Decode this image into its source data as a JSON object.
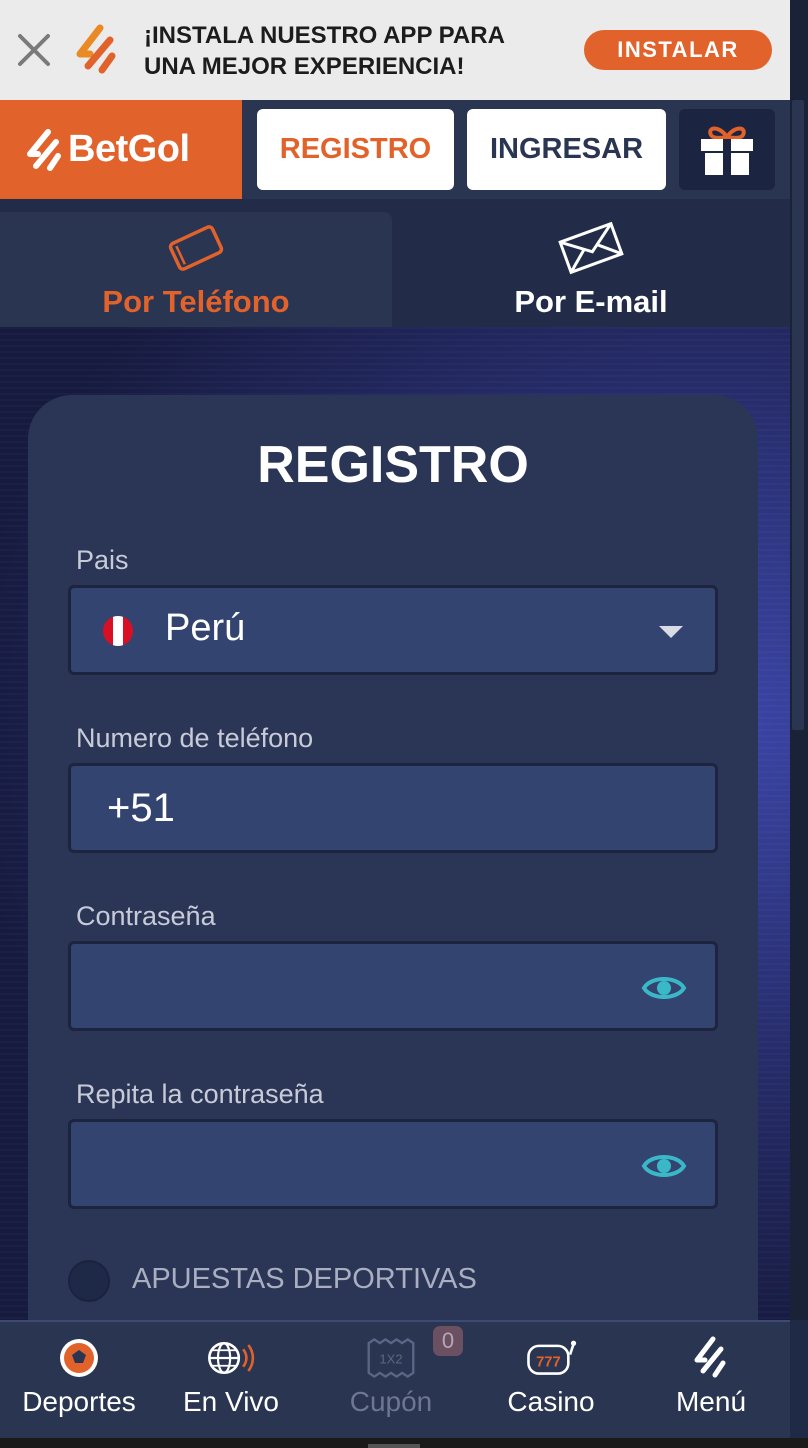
{
  "banner": {
    "message_line1": "¡INSTALA NUESTRO APP PARA",
    "message_line2": "UNA MEJOR EXPERIENCIA!",
    "install_label": "INSTALAR"
  },
  "header": {
    "brand": "BetGol",
    "register_label": "REGISTRO",
    "login_label": "INGRESAR"
  },
  "tabs": [
    {
      "label": "Por Teléfono",
      "icon": "phone-icon",
      "active": true
    },
    {
      "label": "Por E-mail",
      "icon": "envelope-icon",
      "active": false
    }
  ],
  "form": {
    "title": "REGISTRO",
    "country_label": "Pais",
    "country_value": "Perú",
    "phone_label": "Numero de teléfono",
    "phone_value": "+51",
    "password_label": "Contraseña",
    "password_value": "",
    "repeat_password_label": "Repita la contraseña",
    "repeat_password_value": "",
    "radio_label": "APUESTAS DEPORTIVAS"
  },
  "bottom_nav": [
    {
      "label": "Deportes",
      "icon": "soccer-ball-icon",
      "enabled": true
    },
    {
      "label": "En Vivo",
      "icon": "live-globe-icon",
      "enabled": true
    },
    {
      "label": "Cupón",
      "icon": "ticket-icon",
      "enabled": false,
      "badge": "0"
    },
    {
      "label": "Casino",
      "icon": "slot-machine-icon",
      "enabled": true
    },
    {
      "label": "Menú",
      "icon": "menu-logo-icon",
      "enabled": true
    }
  ],
  "colors": {
    "accent": "#e2622b",
    "navy": "#2a3552",
    "field": "#334470",
    "eye": "#3ab8c8"
  }
}
